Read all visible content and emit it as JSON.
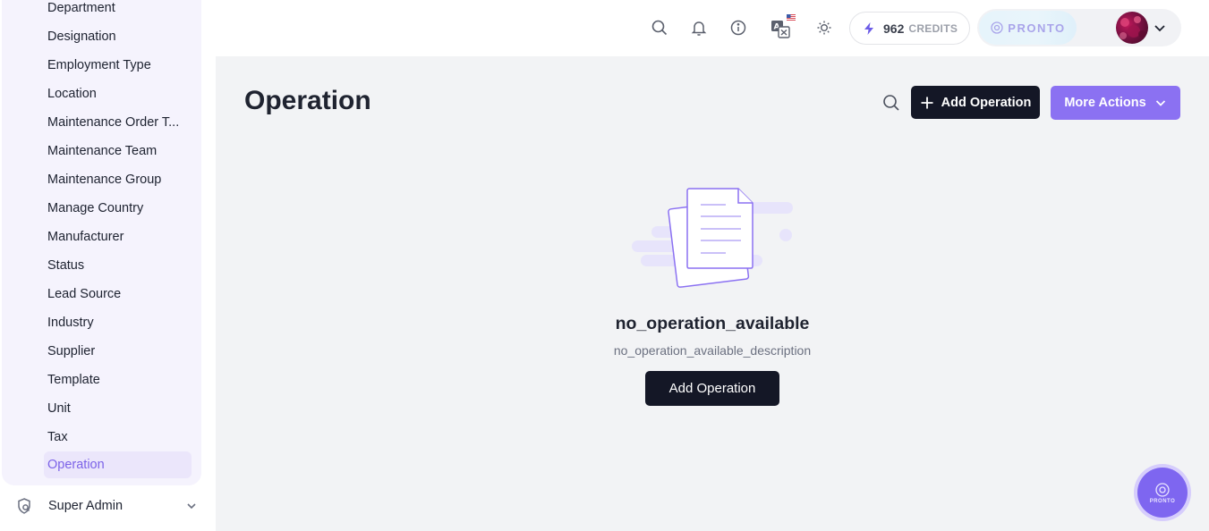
{
  "sidebar": {
    "items": [
      {
        "label": "Department"
      },
      {
        "label": "Designation"
      },
      {
        "label": "Employment Type"
      },
      {
        "label": "Location"
      },
      {
        "label": "Maintenance Order T..."
      },
      {
        "label": "Maintenance Team"
      },
      {
        "label": "Maintenance Group"
      },
      {
        "label": "Manage Country"
      },
      {
        "label": "Manufacturer"
      },
      {
        "label": "Status"
      },
      {
        "label": "Lead Source"
      },
      {
        "label": "Industry"
      },
      {
        "label": "Supplier"
      },
      {
        "label": "Template"
      },
      {
        "label": "Unit"
      },
      {
        "label": "Tax"
      },
      {
        "label": "Operation",
        "active": true
      }
    ],
    "footer": {
      "label": "Super Admin",
      "icon": "super-admin-icon"
    }
  },
  "header": {
    "icons": [
      "search-icon",
      "bell-icon",
      "info-icon",
      "translate-icon",
      "sun-icon"
    ],
    "credits": {
      "value": "962",
      "label": "CREDITS"
    },
    "brand": "PRONTO"
  },
  "main": {
    "title": "Operation",
    "add_button": "Add Operation",
    "more_actions": "More Actions",
    "empty": {
      "title": "no_operation_available",
      "description": "no_operation_available_description",
      "button": "Add Operation"
    }
  },
  "fab": {
    "label": "PRONTO"
  },
  "colors": {
    "accent": "#8b71f2",
    "accent_dark": "#7c63e8",
    "dark_button": "#141726",
    "main_bg": "#f2f3f5",
    "sidebar_bg": "#f5f3fd"
  }
}
